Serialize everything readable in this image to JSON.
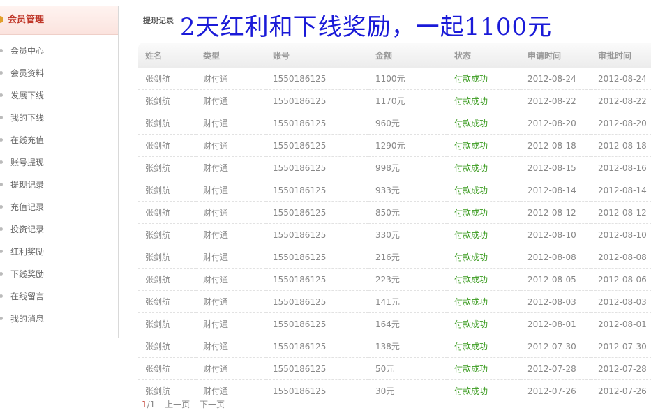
{
  "sidebar": {
    "title": "会员管理",
    "items": [
      {
        "label": "会员中心"
      },
      {
        "label": "会员资料"
      },
      {
        "label": "发展下线"
      },
      {
        "label": "我的下线"
      },
      {
        "label": "在线充值"
      },
      {
        "label": "账号提现"
      },
      {
        "label": "提现记录"
      },
      {
        "label": "充值记录"
      },
      {
        "label": "投资记录"
      },
      {
        "label": "红利奖励"
      },
      {
        "label": "下线奖励"
      },
      {
        "label": "在线留言"
      },
      {
        "label": "我的消息"
      }
    ]
  },
  "main": {
    "tab_label": "提现记录",
    "promo_text": "2天红利和下线奖励，一起1100元"
  },
  "table": {
    "headers": [
      "姓名",
      "类型",
      "账号",
      "金额",
      "状态",
      "申请时间",
      "审批时间"
    ],
    "rows": [
      [
        "张剑航",
        "财付通",
        "1550186125",
        "1100元",
        "付款成功",
        "2012-08-24",
        "2012-08-24"
      ],
      [
        "张剑航",
        "财付通",
        "1550186125",
        "1170元",
        "付款成功",
        "2012-08-22",
        "2012-08-22"
      ],
      [
        "张剑航",
        "财付通",
        "1550186125",
        "960元",
        "付款成功",
        "2012-08-20",
        "2012-08-20"
      ],
      [
        "张剑航",
        "财付通",
        "1550186125",
        "1290元",
        "付款成功",
        "2012-08-18",
        "2012-08-18"
      ],
      [
        "张剑航",
        "财付通",
        "1550186125",
        "998元",
        "付款成功",
        "2012-08-15",
        "2012-08-16"
      ],
      [
        "张剑航",
        "财付通",
        "1550186125",
        "933元",
        "付款成功",
        "2012-08-14",
        "2012-08-14"
      ],
      [
        "张剑航",
        "财付通",
        "1550186125",
        "850元",
        "付款成功",
        "2012-08-12",
        "2012-08-12"
      ],
      [
        "张剑航",
        "财付通",
        "1550186125",
        "330元",
        "付款成功",
        "2012-08-10",
        "2012-08-10"
      ],
      [
        "张剑航",
        "财付通",
        "1550186125",
        "216元",
        "付款成功",
        "2012-08-08",
        "2012-08-08"
      ],
      [
        "张剑航",
        "财付通",
        "1550186125",
        "223元",
        "付款成功",
        "2012-08-05",
        "2012-08-06"
      ],
      [
        "张剑航",
        "财付通",
        "1550186125",
        "141元",
        "付款成功",
        "2012-08-03",
        "2012-08-03"
      ],
      [
        "张剑航",
        "财付通",
        "1550186125",
        "164元",
        "付款成功",
        "2012-08-01",
        "2012-08-01"
      ],
      [
        "张剑航",
        "财付通",
        "1550186125",
        "138元",
        "付款成功",
        "2012-07-30",
        "2012-07-30"
      ],
      [
        "张剑航",
        "财付通",
        "1550186125",
        "50元",
        "付款成功",
        "2012-07-28",
        "2012-07-28"
      ],
      [
        "张剑航",
        "财付通",
        "1550186125",
        "30元",
        "付款成功",
        "2012-07-26",
        "2012-07-26"
      ]
    ]
  },
  "pager": {
    "current": "1",
    "total": "/1",
    "prev": "上一页",
    "next": "下一页"
  },
  "colors": {
    "sidebar_title": "#c0392b",
    "promo": "#1a1ad8",
    "status_success": "#3a9b1f"
  }
}
